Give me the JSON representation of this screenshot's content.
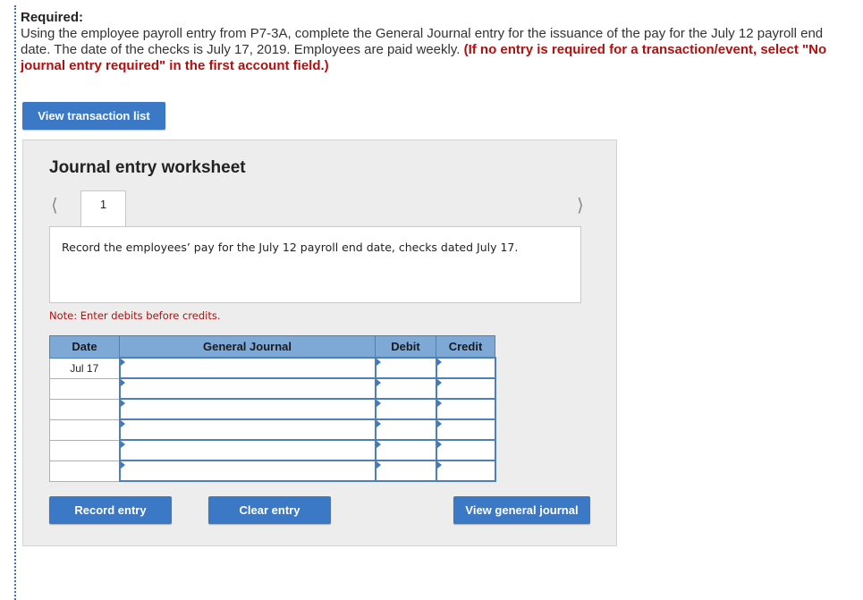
{
  "required": {
    "title": "Required:",
    "text": "Using the employee payroll entry from P7-3A, complete the General Journal entry for the issuance of the pay for the July 12 payroll end date. The date of the checks is July 17, 2019. Employees are paid weekly.",
    "highlight": "(If no entry is required for a transaction/event, select \"No journal entry required\" in the first account field.)"
  },
  "buttons": {
    "view_transaction_list": "View transaction list",
    "record_entry": "Record entry",
    "clear_entry": "Clear entry",
    "view_general_journal": "View general journal"
  },
  "worksheet": {
    "title": "Journal entry worksheet",
    "prev_icon": "chevron-left-icon",
    "next_icon": "chevron-right-icon",
    "tab_label": "1",
    "description": "Record the employees’ pay for the July 12 payroll end date, checks dated July 17.",
    "note": "Note: Enter debits before credits."
  },
  "journal_table": {
    "headers": [
      "Date",
      "General Journal",
      "Debit",
      "Credit"
    ],
    "rows": [
      {
        "date": "Jul 17",
        "account": "",
        "debit": "",
        "credit": ""
      },
      {
        "date": "",
        "account": "",
        "debit": "",
        "credit": ""
      },
      {
        "date": "",
        "account": "",
        "debit": "",
        "credit": ""
      },
      {
        "date": "",
        "account": "",
        "debit": "",
        "credit": ""
      },
      {
        "date": "",
        "account": "",
        "debit": "",
        "credit": ""
      },
      {
        "date": "",
        "account": "",
        "debit": "",
        "credit": ""
      }
    ]
  },
  "colors": {
    "button": "#3b78c6",
    "header": "#7ea9d7",
    "alert_red": "#b40f0f"
  }
}
